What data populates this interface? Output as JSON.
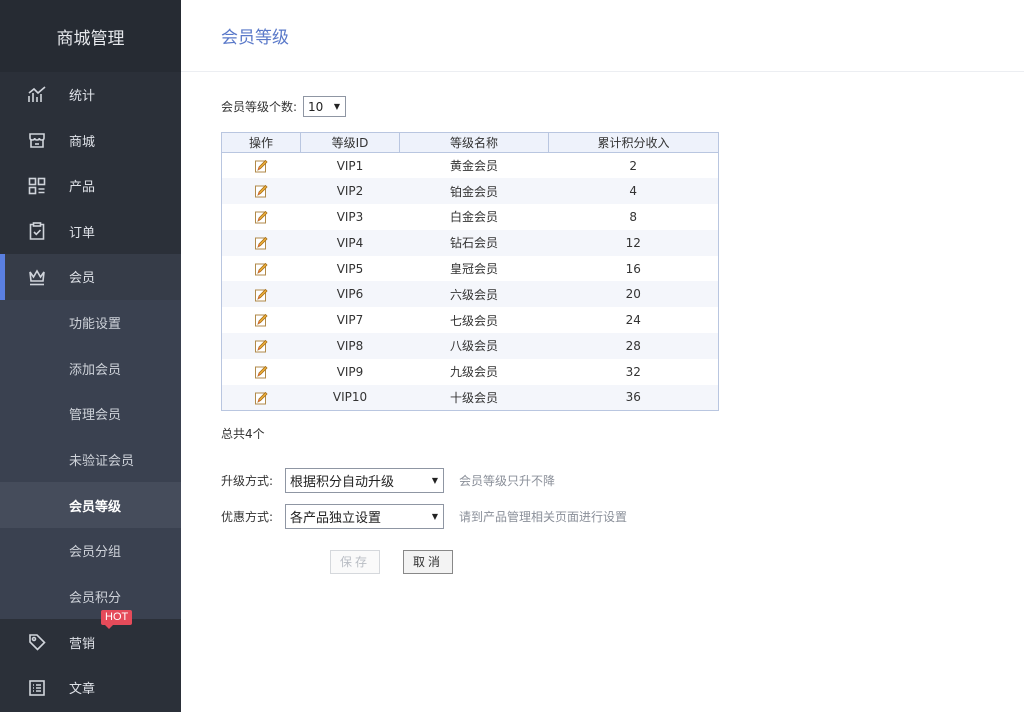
{
  "sidebar": {
    "brand": "商城管理",
    "items": [
      {
        "label": "统计",
        "icon": "chart-icon"
      },
      {
        "label": "商城",
        "icon": "store-icon"
      },
      {
        "label": "产品",
        "icon": "grid-icon"
      },
      {
        "label": "订单",
        "icon": "clipboard-icon"
      },
      {
        "label": "会员",
        "icon": "crown-icon"
      },
      {
        "label": "营销",
        "icon": "tag-icon",
        "badge": "HOT"
      },
      {
        "label": "文章",
        "icon": "list-icon"
      }
    ],
    "member_sub": [
      "功能设置",
      "添加会员",
      "管理会员",
      "未验证会员",
      "会员等级",
      "会员分组",
      "会员积分"
    ]
  },
  "page": {
    "title": "会员等级"
  },
  "level_count": {
    "label": "会员等级个数:",
    "value": "10"
  },
  "table": {
    "headers": [
      "操作",
      "等级ID",
      "等级名称",
      "累计积分收入"
    ],
    "rows": [
      {
        "id": "VIP1",
        "name": "黄金会员",
        "points": "2"
      },
      {
        "id": "VIP2",
        "name": "铂金会员",
        "points": "4"
      },
      {
        "id": "VIP3",
        "name": "白金会员",
        "points": "8"
      },
      {
        "id": "VIP4",
        "name": "钻石会员",
        "points": "12"
      },
      {
        "id": "VIP5",
        "name": "皇冠会员",
        "points": "16"
      },
      {
        "id": "VIP6",
        "name": "六级会员",
        "points": "20"
      },
      {
        "id": "VIP7",
        "name": "七级会员",
        "points": "24"
      },
      {
        "id": "VIP8",
        "name": "八级会员",
        "points": "28"
      },
      {
        "id": "VIP9",
        "name": "九级会员",
        "points": "32"
      },
      {
        "id": "VIP10",
        "name": "十级会员",
        "points": "36"
      }
    ],
    "total": "总共4个"
  },
  "form": {
    "upgrade": {
      "label": "升级方式:",
      "value": "根据积分自动升级",
      "hint": "会员等级只升不降"
    },
    "discount": {
      "label": "优惠方式:",
      "value": "各产品独立设置",
      "hint": "请到产品管理相关页面进行设置"
    },
    "save_label": "保存",
    "cancel_label": "取消"
  },
  "colors": {
    "sidebar_bg": "#2b3039",
    "accent": "#5a7fe0",
    "title": "#5a79c9",
    "hot_badge": "#e54b5a"
  }
}
